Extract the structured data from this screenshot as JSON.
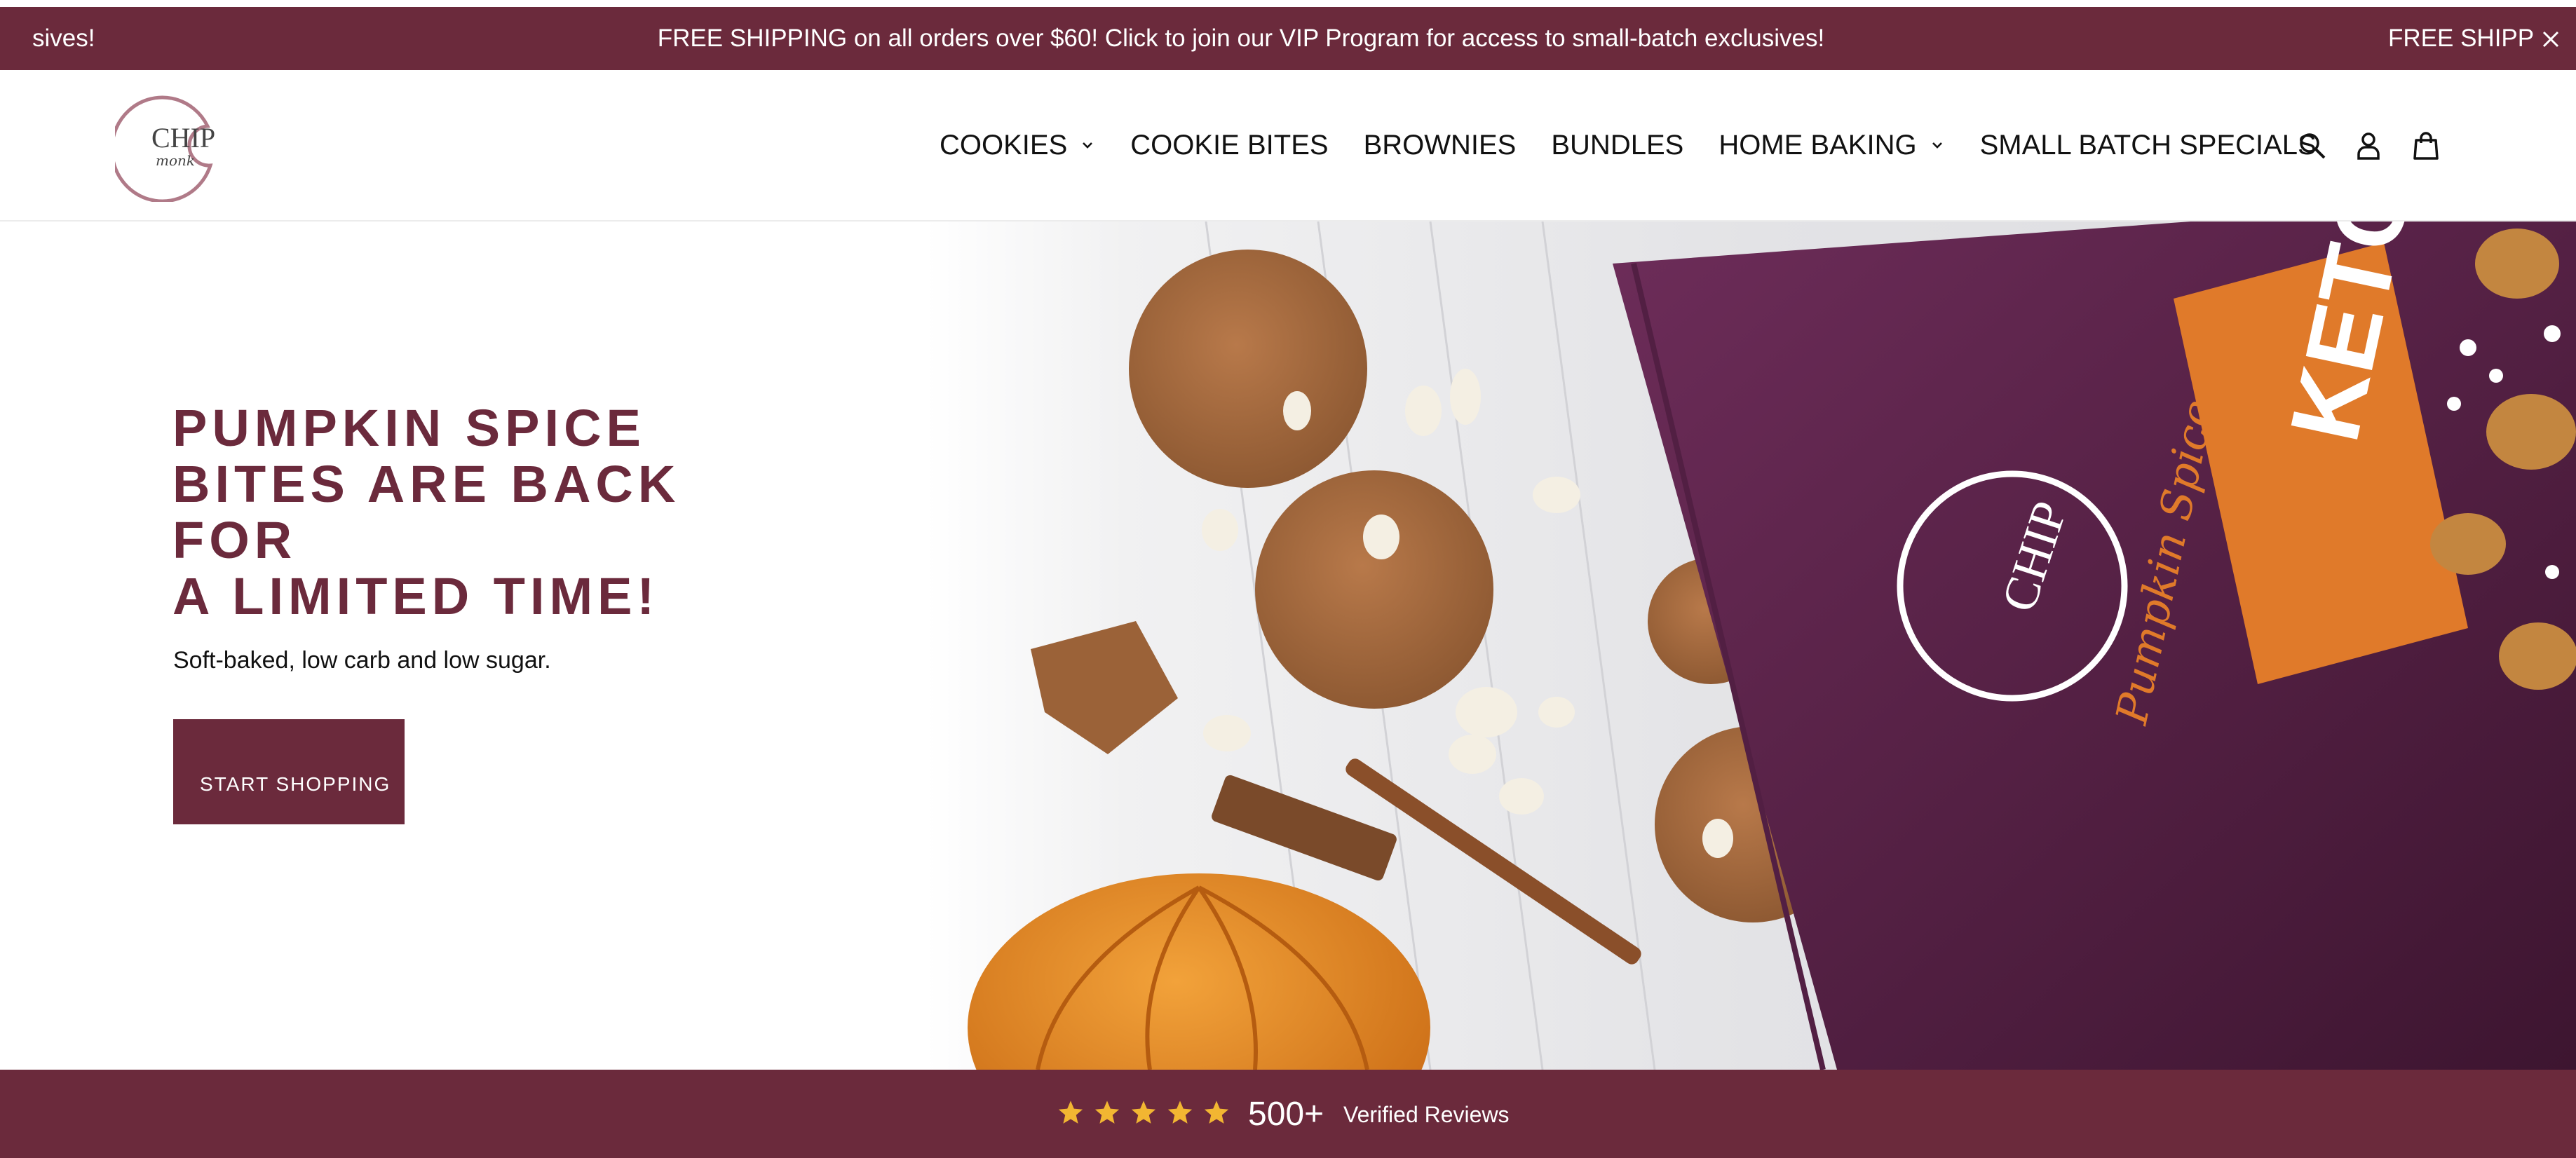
{
  "announcement": {
    "left_fragment": "sives!",
    "message": "FREE SHIPPING on all orders over $60! Click to join our VIP Program for access to small-batch exclusives!",
    "right_fragment": "FREE SHIPPIN",
    "close_icon": "close-icon",
    "background": "#6b2a3c"
  },
  "header": {
    "logo": {
      "line1": "CHIP",
      "line2": "monk",
      "icon": "chipmonk-logo"
    },
    "nav": [
      {
        "label": "COOKIES",
        "has_dropdown": true
      },
      {
        "label": "COOKIE BITES",
        "has_dropdown": false
      },
      {
        "label": "BROWNIES",
        "has_dropdown": false
      },
      {
        "label": "BUNDLES",
        "has_dropdown": false
      },
      {
        "label": "HOME BAKING",
        "has_dropdown": true
      },
      {
        "label": "SMALL BATCH SPECIALS",
        "has_dropdown": false
      }
    ],
    "icons": [
      "search-icon",
      "account-icon",
      "cart-icon"
    ]
  },
  "hero": {
    "headline_lines": [
      "PUMPKIN SPICE",
      "BITES ARE BACK",
      "FOR",
      "A LIMITED TIME!"
    ],
    "subtext": "Soft-baked, low carb and low sugar.",
    "cta_label": "START SHOPPING",
    "product_bag_text": "KETO",
    "product_bag_subtext": "Pumpkin Spice",
    "accent_color": "#6b2a3c"
  },
  "reviews": {
    "rating": 5,
    "count": "500+",
    "label": "Verified Reviews",
    "star_color": "#f2b632"
  }
}
